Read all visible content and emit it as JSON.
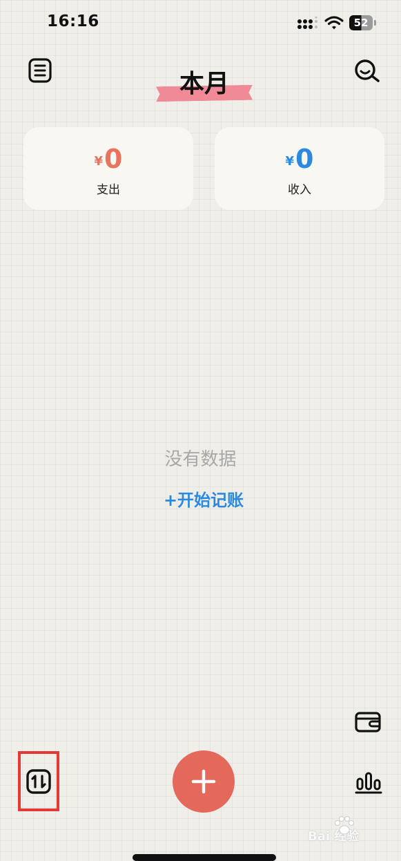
{
  "status_bar": {
    "time": "16:16",
    "battery_level": "52",
    "battery_fraction": 0.52
  },
  "header": {
    "title": "本月",
    "title_tape_color": "#f08a96",
    "menu_icon": "notebook-list-icon",
    "search_icon": "search-icon"
  },
  "summary": {
    "expense": {
      "currency": "¥",
      "amount": "0",
      "label": "支出",
      "color": "#e8735f"
    },
    "income": {
      "currency": "¥",
      "amount": "0",
      "label": "收入",
      "color": "#2b8ae0"
    }
  },
  "empty_state": {
    "message": "没有数据",
    "action_label": "+开始记账",
    "action_color": "#2b8ae0"
  },
  "bottom_bar": {
    "wallet_icon": "wallet-icon",
    "sort_icon": "sort-arrows-icon",
    "add_icon": "plus-icon",
    "add_color": "#e4695a",
    "stats_icon": "bar-chart-icon",
    "highlight_color": "#e53935"
  },
  "watermark": {
    "text": "Bai  经验"
  }
}
